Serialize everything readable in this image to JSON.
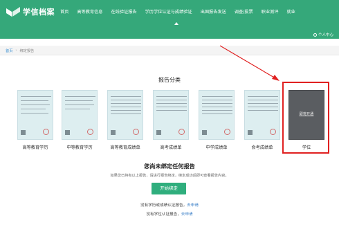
{
  "header": {
    "logo_text": "学信档案",
    "nav": [
      {
        "label": "首页"
      },
      {
        "label": "高等教育信息"
      },
      {
        "label": "在线验证报告"
      },
      {
        "label": "学历学位认证与成绩验证"
      },
      {
        "label": "出国报告发送"
      },
      {
        "label": "调查/投票"
      },
      {
        "label": "职业测评"
      },
      {
        "label": "就业"
      }
    ],
    "user_center": "个人中心",
    "bg_color": "#35a87a"
  },
  "breadcrumb": {
    "home": "首页",
    "current": "绑定报告"
  },
  "section_title": "报告分类",
  "cards": [
    {
      "label": "高等教育学历"
    },
    {
      "label": "中等教育学历"
    },
    {
      "label": "高等教育成绩单"
    },
    {
      "label": "高考成绩单"
    },
    {
      "label": "中学成绩单"
    },
    {
      "label": "会考成绩单"
    },
    {
      "label": "学位",
      "overlay": "即将开通"
    }
  ],
  "empty": {
    "title": "您尚未绑定任何报告",
    "desc": "如果您已持有以上报告，请进行报告绑定，绑定成功后即可查看报告内容。",
    "button": "开始绑定"
  },
  "footer": {
    "row1_text": "没有学历或成绩认证报告，",
    "row1_link": "去申请",
    "row2_text": "没有学位认证报告，",
    "row2_link": "去申请"
  },
  "annotation_color": "#e02020"
}
